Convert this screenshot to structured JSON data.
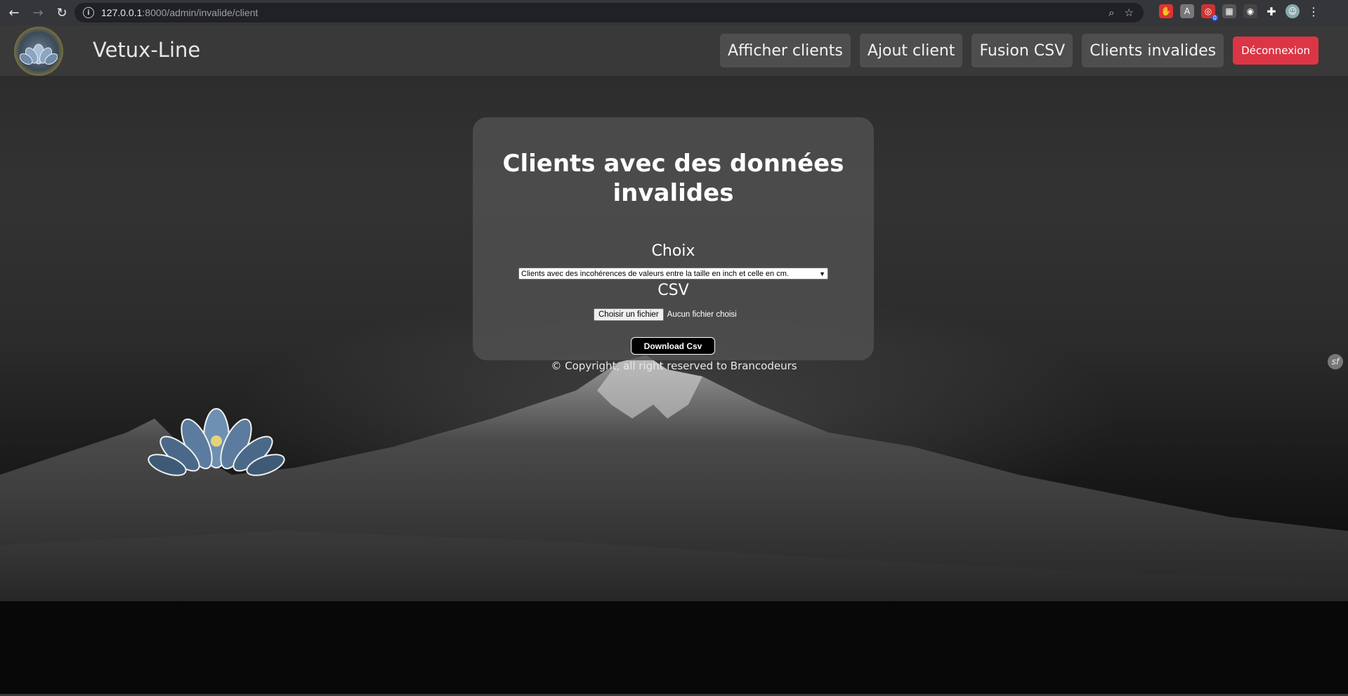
{
  "browser": {
    "url_host": "127.0.0.1",
    "url_path": ":8000/admin/invalide/client",
    "extension_badge": "0"
  },
  "site": {
    "brand": "Vetux-Line",
    "nav": [
      {
        "label": "Afficher clients"
      },
      {
        "label": "Ajout client"
      },
      {
        "label": "Fusion CSV"
      },
      {
        "label": "Clients invalides"
      }
    ],
    "logout_label": "Déconnexion"
  },
  "card": {
    "title": "Clients avec des données invalides",
    "choix_label": "Choix",
    "select_value": "Clients avec des incohérences de valeurs entre la taille en inch et celle en cm.",
    "csv_label": "CSV",
    "file_button": "Choisir un fichier",
    "file_status": "Aucun fichier choisi",
    "download_label": "Download Csv"
  },
  "footer": {
    "copyright": "© Copyright, all right reserved to Brancodeurs"
  },
  "colors": {
    "accent_danger": "#dc3545",
    "nav_bg": "#4e4e4e",
    "card_bg": "#505050"
  }
}
